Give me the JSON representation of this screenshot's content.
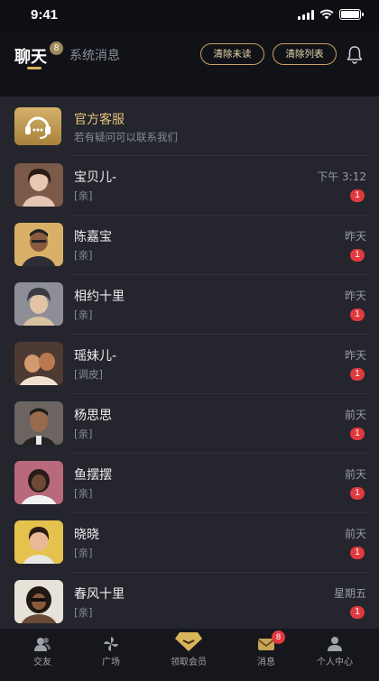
{
  "status": {
    "time": "9:41"
  },
  "header": {
    "tab_chat": "聊天",
    "tab_chat_badge": "8",
    "tab_system": "系统消息",
    "clear_unread": "清除未读",
    "clear_list": "清除列表"
  },
  "customer_service": {
    "name": "官方客服",
    "subtitle": "若有疑问可以联系我们"
  },
  "conversations": [
    {
      "name": "宝贝儿-",
      "preview": "[亲]",
      "time": "下午 3:12",
      "unread": "1",
      "colors": [
        "#7b5a4a",
        "#e7c7b3"
      ]
    },
    {
      "name": "陈嘉宝",
      "preview": "[亲]",
      "time": "昨天",
      "unread": "1",
      "colors": [
        "#d9b067",
        "#5a3a2a"
      ]
    },
    {
      "name": "相约十里",
      "preview": "[亲]",
      "time": "昨天",
      "unread": "1",
      "colors": [
        "#8e8e96",
        "#d8c2a2"
      ]
    },
    {
      "name": "瑶妹儿-",
      "preview": "[调皮]",
      "time": "昨天",
      "unread": "1",
      "colors": [
        "#4c3a33",
        "#d39a6f"
      ]
    },
    {
      "name": "杨思思",
      "preview": "[亲]",
      "time": "前天",
      "unread": "1",
      "colors": [
        "#6b6460",
        "#9a6a4f"
      ]
    },
    {
      "name": "鱼摆摆",
      "preview": "[亲]",
      "time": "前天",
      "unread": "1",
      "colors": [
        "#b86a7c",
        "#3a2a25"
      ]
    },
    {
      "name": "晓晓",
      "preview": "[亲]",
      "time": "前天",
      "unread": "1",
      "colors": [
        "#e5c14d",
        "#c27f5a"
      ]
    },
    {
      "name": "春风十里",
      "preview": "[亲]",
      "time": "星期五",
      "unread": "1",
      "colors": [
        "#e7e2d8",
        "#6a4b38"
      ]
    }
  ],
  "tabbar": {
    "items": [
      {
        "label": "交友",
        "icon": "people-icon"
      },
      {
        "label": "广场",
        "icon": "pinwheel-icon"
      },
      {
        "label": "领取会员",
        "icon": "gem-icon"
      },
      {
        "label": "消息",
        "icon": "envelope-icon",
        "badge": "8"
      },
      {
        "label": "个人中心",
        "icon": "person-icon"
      }
    ]
  },
  "colors": {
    "accent": "#d9b45a",
    "badge": "#e0393e",
    "list_bg": "#24252d"
  }
}
